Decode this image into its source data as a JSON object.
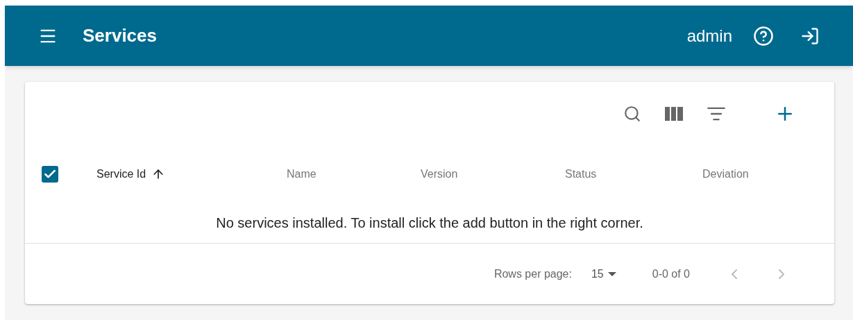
{
  "app_bar": {
    "title": "Services",
    "user": "admin"
  },
  "table": {
    "select_all": {
      "checked": true
    },
    "columns": [
      {
        "label": "Service Id",
        "sorted": true
      },
      {
        "label": "Name",
        "sorted": false
      },
      {
        "label": "Version",
        "sorted": false
      },
      {
        "label": "Status",
        "sorted": false
      },
      {
        "label": "Deviation",
        "sorted": false
      }
    ],
    "empty_message": "No services installed. To install click the add button in the right corner."
  },
  "pagination": {
    "rows_per_page_label": "Rows per page:",
    "rows_per_page": "15",
    "range": "0-0 of 0",
    "prev_disabled": true,
    "next_disabled": true
  }
}
